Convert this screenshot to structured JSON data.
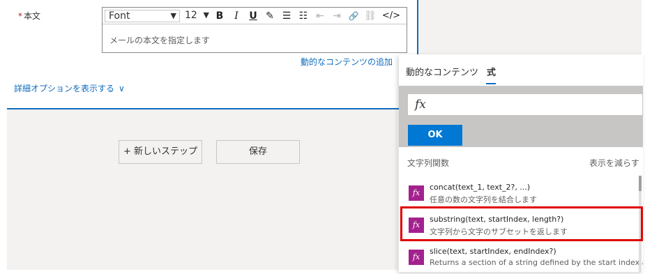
{
  "form": {
    "body_label": "本文",
    "required_marker": "*",
    "editor": {
      "font": "Font",
      "font_size": "12",
      "placeholder": "メールの本文を指定します"
    },
    "dynamic_content_link": "動的なコンテンツの追加",
    "advanced_options_link": "詳細オプションを表示する"
  },
  "canvas": {
    "new_step_button": "+ 新しいステップ",
    "save_button": "保存"
  },
  "panel": {
    "tabs": [
      {
        "label": "動的なコンテンツ"
      },
      {
        "label": "式"
      }
    ],
    "fx_symbol": "fx",
    "ok_button": "OK",
    "section_title": "文字列関数",
    "show_less": "表示を減らす",
    "functions": [
      {
        "signature": "concat(text_1, text_2?, ...)",
        "description": "任意の数の文字列を結合します"
      },
      {
        "signature": "substring(text, startIndex, length?)",
        "description": "文字列から文字のサブセットを返します"
      },
      {
        "signature": "slice(text, startIndex, endIndex?)",
        "description": "Returns a section of a string defined by the start index an..."
      }
    ]
  },
  "icons": {
    "bold": "B",
    "italic": "I",
    "underline": "U",
    "pen": "✎",
    "bullets": "☰",
    "numbered": "☷",
    "outdent": "⇤",
    "indent": "⇥",
    "link": "🔗",
    "unlink": "⛓",
    "code": "</>",
    "chevron_down": "▼",
    "chevron": "∨"
  },
  "colors": {
    "accent": "#0f6cbd",
    "ok_button": "#0078d4",
    "fx_tile": "#a3218e",
    "highlight": "#e00000"
  }
}
